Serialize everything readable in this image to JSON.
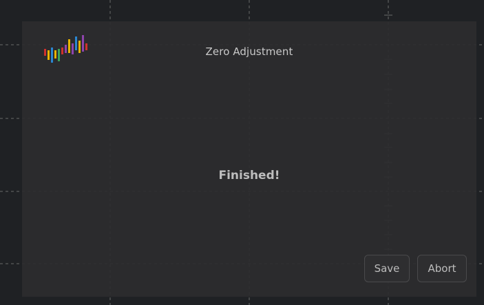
{
  "dialog": {
    "title": "Zero Adjustment",
    "status": "Finished!"
  },
  "buttons": {
    "save_label": "Save",
    "abort_label": "Abort"
  },
  "colors": {
    "background": "#1f2124",
    "panel": "#2c2c2e",
    "text": "#c9c9c9",
    "grid": "#6a6a6a"
  },
  "logo": {
    "icon": "equalizer-bars-logo"
  }
}
